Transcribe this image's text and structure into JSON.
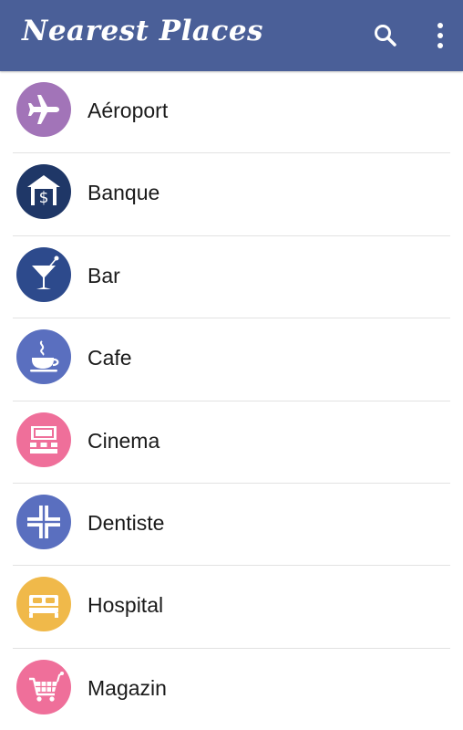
{
  "appbar": {
    "title": "Nearest Places",
    "color": "#4a5f98",
    "actions": [
      {
        "icon": "search-icon"
      },
      {
        "icon": "more-vert-icon"
      }
    ]
  },
  "places": [
    {
      "label": "Aéroport",
      "icon": "airplane-icon",
      "color": "#a274b8"
    },
    {
      "label": "Banque",
      "icon": "bank-icon",
      "color": "#1f3767"
    },
    {
      "label": "Bar",
      "icon": "cocktail-glass-icon",
      "color": "#2d4a8c"
    },
    {
      "label": "Cafe",
      "icon": "coffee-cup-icon",
      "color": "#5a6fbf"
    },
    {
      "label": "Cinema",
      "icon": "cinema-icon",
      "color": "#ef6f9a"
    },
    {
      "label": "Dentiste",
      "icon": "medical-cross-icon",
      "color": "#5a6fbf"
    },
    {
      "label": "Hospital",
      "icon": "hospital-bed-icon",
      "color": "#f0b94a"
    },
    {
      "label": "Magazin",
      "icon": "shopping-cart-icon",
      "color": "#ef6f9a"
    }
  ]
}
